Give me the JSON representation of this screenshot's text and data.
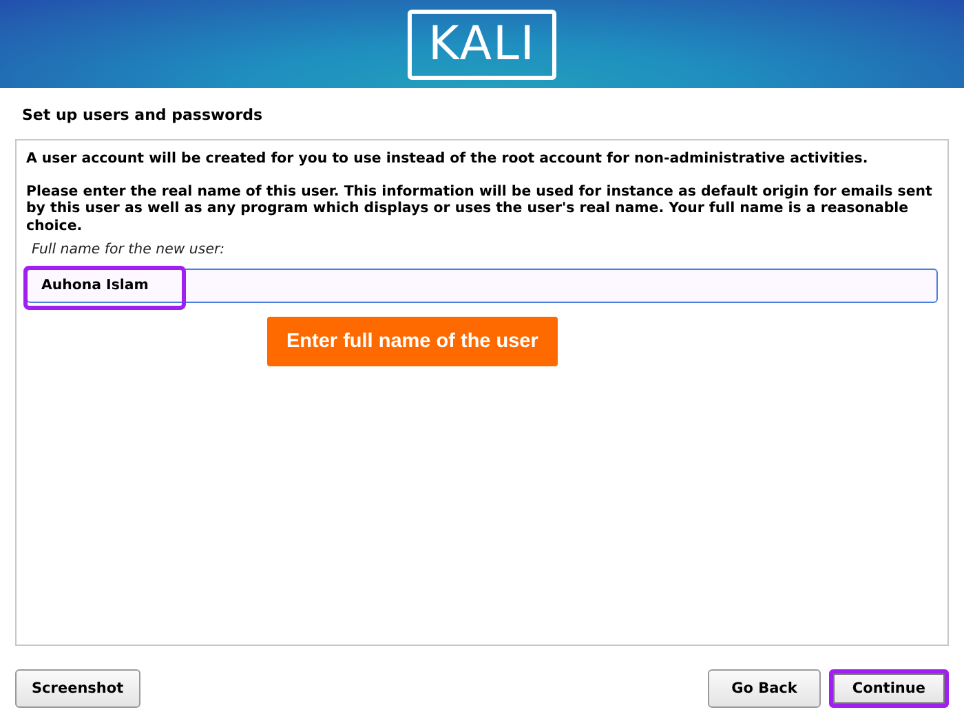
{
  "header": {
    "logo": "KALI"
  },
  "page_title": "Set up users and passwords",
  "paragraphs": [
    "A user account will be created for you to use instead of the root account for non-administrative activities.",
    "Please enter the real name of this user. This information will be used for instance as default origin for emails sent by this user as well as any program which displays or uses the user's real name. Your full name is a reasonable choice."
  ],
  "field": {
    "label": "Full name for the new user:",
    "value": "Auhona Islam",
    "highlighted": true
  },
  "callout": "Enter full name of the user",
  "buttons": [
    {
      "label": "Screenshot",
      "highlighted": false
    },
    {
      "label": "Go Back",
      "highlighted": false
    },
    {
      "label": "Continue",
      "highlighted": true
    }
  ]
}
